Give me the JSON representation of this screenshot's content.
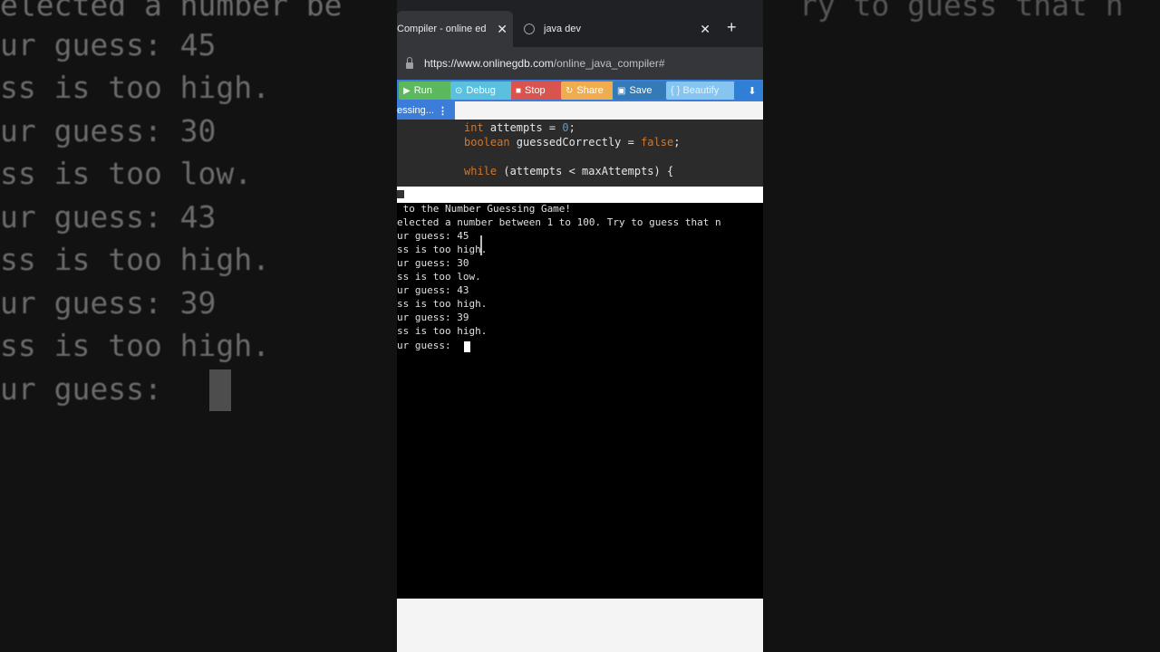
{
  "background_zoom": {
    "lines": [
      "elected a number be",
      "ur guess: 45",
      "ss is too high.",
      "ur guess: 30",
      "ss is too low.",
      "ur guess: 43",
      "ss is too high.",
      "ur guess: 39",
      "ss is too high.",
      "ur guess:"
    ],
    "right_line": "ry to guess that n"
  },
  "browser": {
    "tabs": [
      {
        "title": "Compiler - online ed",
        "active": true
      },
      {
        "title": "java dev",
        "active": false
      }
    ],
    "new_tab": "+",
    "url_domain": "https://www.onlinegdb.com",
    "url_path": "/online_java_compiler#"
  },
  "toolbar": {
    "run": "Run",
    "debug": "Debug",
    "stop": "Stop",
    "share": "Share",
    "save": "Save",
    "beautify": "{ } Beautify"
  },
  "file_tab": {
    "name": "essing...",
    "menu": "⋮"
  },
  "editor": {
    "line1_type": "int",
    "line1_rest": " attempts = ",
    "line1_val": "0",
    "line1_end": ";",
    "line2_type": "boolean",
    "line2_rest": " guessedCorrectly = ",
    "line2_val": "false",
    "line2_end": ";",
    "line3_kw": "while",
    "line3_rest": " (attempts < maxAttempts) {"
  },
  "console": {
    "lines": [
      " to the Number Guessing Game!",
      "elected a number between 1 to 100. Try to guess that n",
      "ur guess: 45",
      "ss is too high.",
      "ur guess: 30",
      "ss is too low.",
      "ur guess: 43",
      "ss is too high.",
      "ur guess: 39",
      "ss is too high.",
      "ur guess: "
    ]
  }
}
